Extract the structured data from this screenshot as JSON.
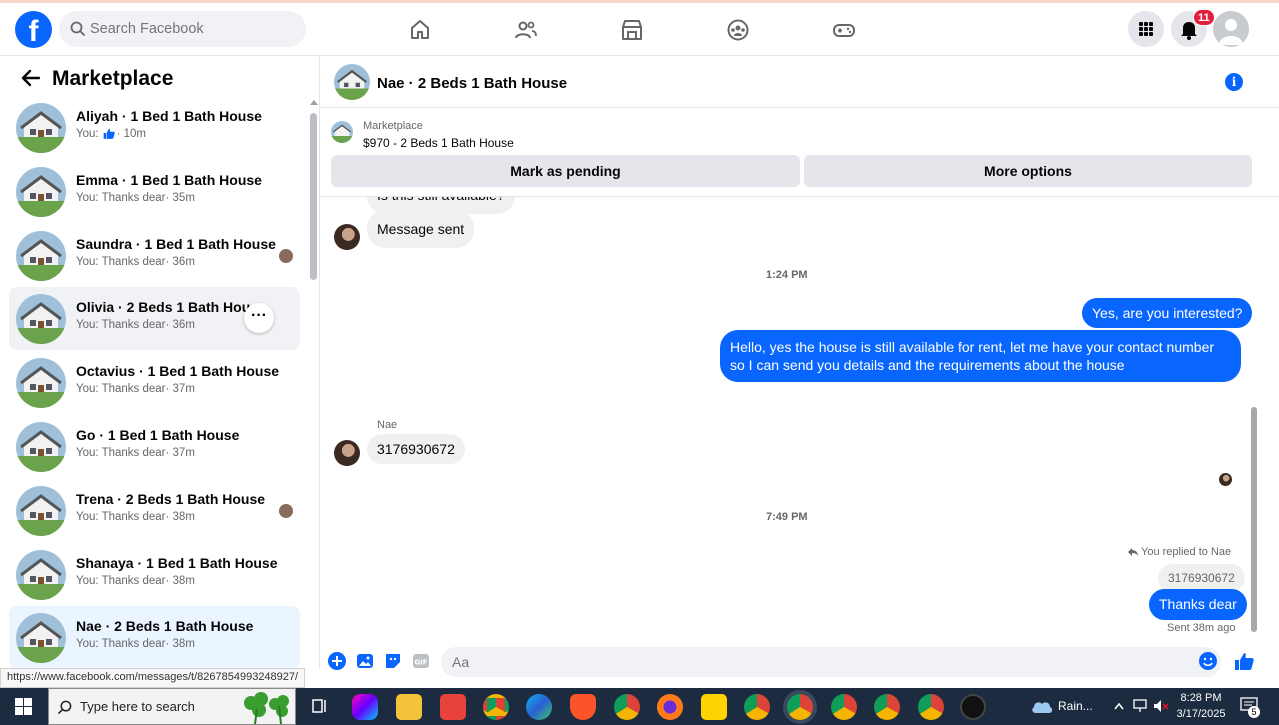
{
  "search": {
    "placeholder": "Search Facebook"
  },
  "topbar": {
    "notification_count": "11"
  },
  "sidebar": {
    "title": "Marketplace",
    "conversations": [
      {
        "name": "Aliyah · 1 Bed 1 Bath House",
        "preview": "You:",
        "time": "· 10m"
      },
      {
        "name": "Emma · 1 Bed 1 Bath House",
        "preview": "You: Thanks dear",
        "time": "· 35m"
      },
      {
        "name": "Saundra · 1 Bed 1 Bath House",
        "preview": "You: Thanks dear",
        "time": "· 36m"
      },
      {
        "name": "Olivia · 2 Beds 1 Bath House",
        "preview": "You: Thanks dear",
        "time": "· 36m"
      },
      {
        "name": "Octavius · 1 Bed 1 Bath House",
        "preview": "You: Thanks dear",
        "time": "· 37m"
      },
      {
        "name": "Go · 1 Bed 1 Bath House",
        "preview": "You: Thanks dear",
        "time": "· 37m"
      },
      {
        "name": "Trena · 2 Beds 1 Bath House",
        "preview": "You: Thanks dear",
        "time": "· 38m"
      },
      {
        "name": "Shanaya · 1 Bed 1 Bath House",
        "preview": "You: Thanks dear",
        "time": "· 38m"
      },
      {
        "name": "Nae · 2 Beds 1 Bath House",
        "preview": "You: Thanks dear",
        "time": "· 38m"
      }
    ]
  },
  "chat": {
    "title": "Nae · 2 Beds 1 Bath House",
    "marketplace_label": "Marketplace",
    "listing": "$970 - 2 Beds 1 Bath House",
    "mark_pending": "Mark as pending",
    "more_options": "More options",
    "messages": {
      "partial": "Is this still available?",
      "msg_sent": "Message sent",
      "time1": "1:24 PM",
      "out1": "Yes, are you interested?",
      "out2": "Hello, yes the house is still available for rent, let me have your contact number so I can send you details and the requirements about the house",
      "sender": "Nae",
      "in_number": "3176930672",
      "time2": "7:49 PM",
      "replied_to": "You replied to Nae",
      "quoted": "3176930672",
      "out3": "Thanks dear",
      "sent_status": "Sent 38m ago"
    },
    "composer_placeholder": "Aa"
  },
  "status_url": "https://www.facebook.com/messages/t/8267854993248927/",
  "taskbar": {
    "search_placeholder": "Type here to search",
    "weather": "Rain...",
    "time": "8:28 PM",
    "date": "3/17/2025",
    "notifications": "5"
  }
}
